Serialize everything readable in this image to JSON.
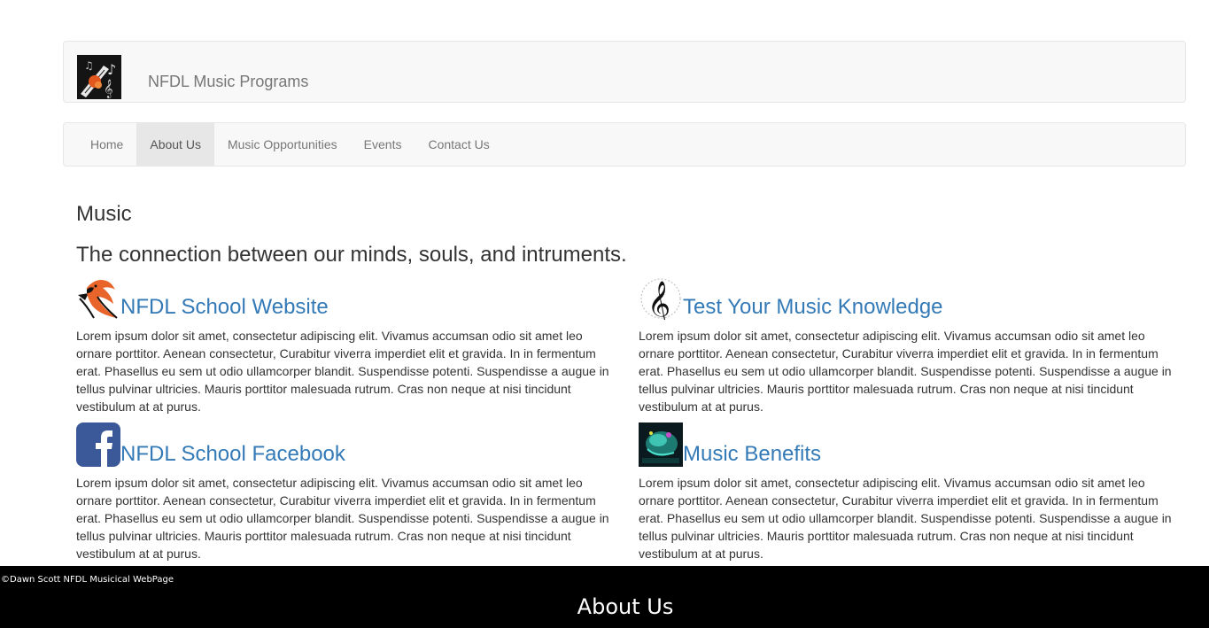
{
  "brand": {
    "title": "NFDL Music Programs",
    "logo_icon": "music-notes-logo-icon"
  },
  "nav": {
    "items": [
      {
        "label": "Home",
        "active": false
      },
      {
        "label": "About Us",
        "active": true
      },
      {
        "label": "Music Opportunities",
        "active": false
      },
      {
        "label": "Events",
        "active": false
      },
      {
        "label": "Contact Us",
        "active": false
      }
    ]
  },
  "main": {
    "heading": "Music",
    "tagline": "The connection between our minds, souls, and intruments.",
    "cards": [
      {
        "title": "NFDL School Website",
        "icon": "cardinal-bird-icon",
        "body": "Lorem ipsum dolor sit amet, consectetur adipiscing elit. Vivamus accumsan odio sit amet leo ornare porttitor. Aenean consectetur, Curabitur viverra imperdiet elit et gravida. In in fermentum erat. Phasellus eu sem ut odio ullamcorper blandit. Suspendisse potenti. Suspendisse a augue in tellus pulvinar ultricies. Mauris porttitor malesuada rutrum. Cras non neque at nisi tincidunt vestibulum at at purus."
      },
      {
        "title": "Test Your Music Knowledge",
        "icon": "treble-clef-icon",
        "body": "Lorem ipsum dolor sit amet, consectetur adipiscing elit. Vivamus accumsan odio sit amet leo ornare porttitor. Aenean consectetur, Curabitur viverra imperdiet elit et gravida. In in fermentum erat. Phasellus eu sem ut odio ullamcorper blandit. Suspendisse potenti. Suspendisse a augue in tellus pulvinar ultricies. Mauris porttitor malesuada rutrum. Cras non neque at nisi tincidunt vestibulum at at purus."
      },
      {
        "title": "NFDL School Facebook",
        "icon": "facebook-icon",
        "body": "Lorem ipsum dolor sit amet, consectetur adipiscing elit. Vivamus accumsan odio sit amet leo ornare porttitor. Aenean consectetur, Curabitur viverra imperdiet elit et gravida. In in fermentum erat. Phasellus eu sem ut odio ullamcorper blandit. Suspendisse potenti. Suspendisse a augue in tellus pulvinar ultricies. Mauris porttitor malesuada rutrum. Cras non neque at nisi tincidunt vestibulum at at purus."
      },
      {
        "title": "Music Benefits",
        "icon": "brain-music-icon",
        "body": "Lorem ipsum dolor sit amet, consectetur adipiscing elit. Vivamus accumsan odio sit amet leo ornare porttitor. Aenean consectetur, Curabitur viverra imperdiet elit et gravida. In in fermentum erat. Phasellus eu sem ut odio ullamcorper blandit. Suspendisse potenti. Suspendisse a augue in tellus pulvinar ultricies. Mauris porttitor malesuada rutrum. Cras non neque at nisi tincidunt vestibulum at at purus."
      }
    ]
  },
  "footer": {
    "copyright": "©Dawn Scott NFDL Musicical WebPage",
    "title": "About Us"
  },
  "colors": {
    "link": "#337ab7",
    "nav_bg": "#f8f8f8",
    "nav_active_bg": "#e7e7e7",
    "footer_bg": "#000000"
  }
}
